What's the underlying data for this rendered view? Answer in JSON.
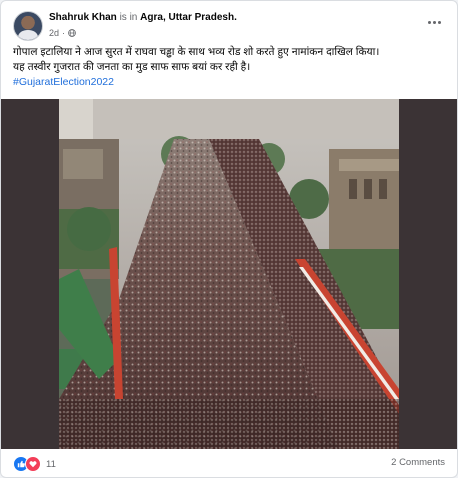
{
  "post": {
    "author": "Shahruk Khan",
    "location_prefix": "is in",
    "location": "Agra, Uttar Pradesh.",
    "time": "2d",
    "visibility_icon": "globe-icon",
    "more_icon": "more-options-icon",
    "text_lines": [
      "गोपाल इटालिया ने आज सुरत में राघवा चड्ढा के साथ भव्य रोड शो करते हुए नामांकन दाखिल किया।",
      "यह तस्वीर गुजरात की जनता का मुड साफ साफ बयां कर रही है।"
    ],
    "hashtag": "#GujaratElection2022",
    "reaction_icons": [
      "like-icon",
      "love-icon"
    ],
    "reaction_count": "11",
    "comments": "2 Comments"
  },
  "colors": {
    "link": "#216fdb",
    "like": "#1877f2",
    "love": "#f33e58",
    "muted": "#65676b",
    "media_background": "#3b3335"
  }
}
